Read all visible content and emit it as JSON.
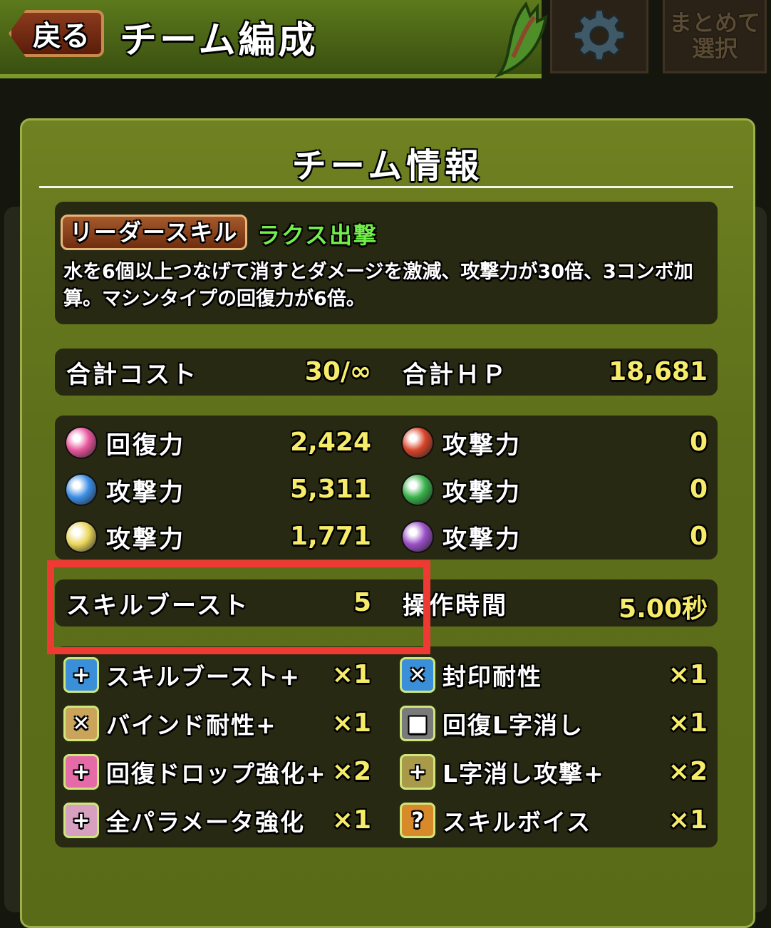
{
  "header": {
    "back_label": "戻る",
    "title": "チーム編成",
    "bulk_select_line1": "まとめて",
    "bulk_select_line2": "選択"
  },
  "panel": {
    "title": "チーム情報",
    "leader": {
      "badge": "リーダースキル",
      "name": "ラクス出撃",
      "description": "水を6個以上つなげて消すとダメージを激減、攻撃力が30倍、3コンボ加算。マシンタイプの回復力が6倍。"
    },
    "totals": {
      "cost_label": "合計コスト",
      "cost_value": "30/∞",
      "hp_label": "合計ＨＰ",
      "hp_value": "18,681"
    },
    "stats": [
      {
        "icon": "heart-orb-icon",
        "color": "#e8559d",
        "label": "回復力",
        "value": "2,424"
      },
      {
        "icon": "fire-orb-icon",
        "color": "#d8452a",
        "label": "攻撃力",
        "value": "0"
      },
      {
        "icon": "water-orb-icon",
        "color": "#3b8ee6",
        "label": "攻撃力",
        "value": "5,311"
      },
      {
        "icon": "wood-orb-icon",
        "color": "#38b24a",
        "label": "攻撃力",
        "value": "0"
      },
      {
        "icon": "light-orb-icon",
        "color": "#e9d65a",
        "label": "攻撃力",
        "value": "1,771"
      },
      {
        "icon": "dark-orb-icon",
        "color": "#9a4fc7",
        "label": "攻撃力",
        "value": "0"
      }
    ],
    "boost": {
      "skill_boost_label": "スキルブースト",
      "skill_boost_value": "5",
      "move_time_label": "操作時間",
      "move_time_value": "5.00秒"
    },
    "awakenings": [
      {
        "icon": "skill-boost-plus-icon",
        "label": "スキルブースト+",
        "count": "×1"
      },
      {
        "icon": "seal-resist-icon",
        "label": "封印耐性",
        "count": "×1"
      },
      {
        "icon": "bind-resist-plus-icon",
        "label": "バインド耐性+",
        "count": "×1"
      },
      {
        "icon": "heal-l-shape-icon",
        "label": "回復L字消し",
        "count": "×1"
      },
      {
        "icon": "enhanced-heal-orb-plus-icon",
        "label": "回復ドロップ強化+",
        "count": "×2"
      },
      {
        "icon": "l-shape-attack-plus-icon",
        "label": "L字消し攻撃+",
        "count": "×2"
      },
      {
        "icon": "all-stats-enhance-icon",
        "label": "全パラメータ強化",
        "count": "×1"
      },
      {
        "icon": "skill-voice-icon",
        "label": "スキルボイス",
        "count": "×1"
      }
    ]
  },
  "colors": {
    "panel": "#6f8121",
    "value_yellow": "#f6ec6a",
    "leader_name_green": "#72f04a",
    "highlight_red": "#ee3a32"
  }
}
